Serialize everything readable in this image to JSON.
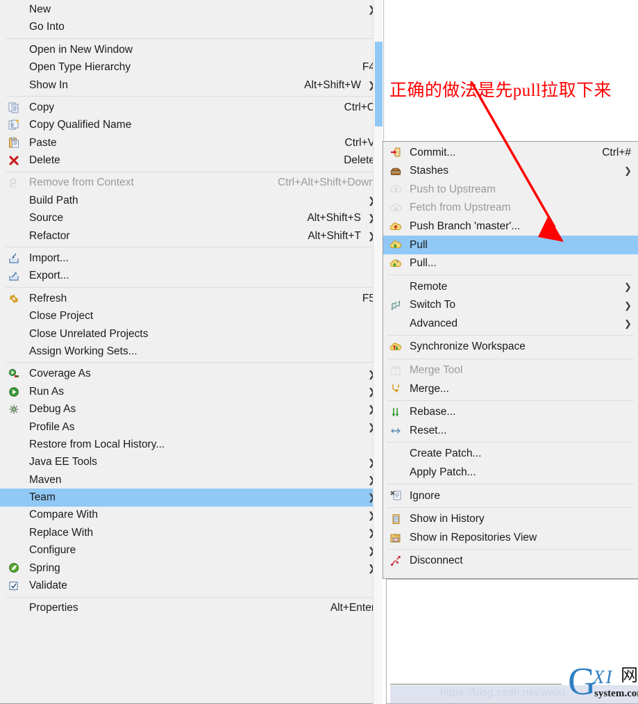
{
  "app": {
    "kind": "eclipse-context-menu",
    "colors": {
      "menu_bg": "#f0f0f0",
      "menu_border": "#9a9a9a",
      "highlight": "#90c8f6",
      "annotation_red": "#ff0000",
      "disabled_text": "#9a9a9a",
      "watermark_blue": "#2f80c2"
    }
  },
  "context_menu": {
    "name": "project-context-menu",
    "groups": [
      {
        "items": [
          {
            "label": "New",
            "accel": "",
            "arrow": true,
            "icon": "",
            "disabled": false,
            "selected": false
          },
          {
            "label": "Go Into",
            "accel": "",
            "arrow": false,
            "icon": "",
            "disabled": false,
            "selected": false
          }
        ]
      },
      {
        "items": [
          {
            "label": "Open in New Window",
            "accel": "",
            "arrow": false,
            "icon": "",
            "disabled": false,
            "selected": false
          },
          {
            "label": "Open Type Hierarchy",
            "accel": "F4",
            "arrow": false,
            "icon": "",
            "disabled": false,
            "selected": false
          },
          {
            "label": "Show In",
            "accel": "Alt+Shift+W",
            "arrow": true,
            "icon": "",
            "disabled": false,
            "selected": false
          }
        ]
      },
      {
        "items": [
          {
            "label": "Copy",
            "accel": "Ctrl+C",
            "arrow": false,
            "icon": "copy-icon",
            "disabled": false,
            "selected": false
          },
          {
            "label": "Copy Qualified Name",
            "accel": "",
            "arrow": false,
            "icon": "copy-qualified-name-icon",
            "disabled": false,
            "selected": false
          },
          {
            "label": "Paste",
            "accel": "Ctrl+V",
            "arrow": false,
            "icon": "paste-icon",
            "disabled": false,
            "selected": false
          },
          {
            "label": "Delete",
            "accel": "Delete",
            "arrow": false,
            "icon": "delete-x-icon",
            "disabled": false,
            "selected": false
          }
        ]
      },
      {
        "items": [
          {
            "label": "Remove from Context",
            "accel": "Ctrl+Alt+Shift+Down",
            "arrow": false,
            "icon": "remove-from-context-icon",
            "disabled": true,
            "selected": false
          },
          {
            "label": "Build Path",
            "accel": "",
            "arrow": true,
            "icon": "",
            "disabled": false,
            "selected": false
          },
          {
            "label": "Source",
            "accel": "Alt+Shift+S",
            "arrow": true,
            "icon": "",
            "disabled": false,
            "selected": false
          },
          {
            "label": "Refactor",
            "accel": "Alt+Shift+T",
            "arrow": true,
            "icon": "",
            "disabled": false,
            "selected": false
          }
        ]
      },
      {
        "items": [
          {
            "label": "Import...",
            "accel": "",
            "arrow": false,
            "icon": "import-icon",
            "disabled": false,
            "selected": false
          },
          {
            "label": "Export...",
            "accel": "",
            "arrow": false,
            "icon": "export-icon",
            "disabled": false,
            "selected": false
          }
        ]
      },
      {
        "items": [
          {
            "label": "Refresh",
            "accel": "F5",
            "arrow": false,
            "icon": "refresh-icon",
            "disabled": false,
            "selected": false
          },
          {
            "label": "Close Project",
            "accel": "",
            "arrow": false,
            "icon": "",
            "disabled": false,
            "selected": false
          },
          {
            "label": "Close Unrelated Projects",
            "accel": "",
            "arrow": false,
            "icon": "",
            "disabled": false,
            "selected": false
          },
          {
            "label": "Assign Working Sets...",
            "accel": "",
            "arrow": false,
            "icon": "",
            "disabled": false,
            "selected": false
          }
        ]
      },
      {
        "items": [
          {
            "label": "Coverage As",
            "accel": "",
            "arrow": true,
            "icon": "coverage-icon",
            "disabled": false,
            "selected": false
          },
          {
            "label": "Run As",
            "accel": "",
            "arrow": true,
            "icon": "run-icon",
            "disabled": false,
            "selected": false
          },
          {
            "label": "Debug As",
            "accel": "",
            "arrow": true,
            "icon": "debug-icon",
            "disabled": false,
            "selected": false
          },
          {
            "label": "Profile As",
            "accel": "",
            "arrow": true,
            "icon": "",
            "disabled": false,
            "selected": false
          },
          {
            "label": "Restore from Local History...",
            "accel": "",
            "arrow": false,
            "icon": "",
            "disabled": false,
            "selected": false
          },
          {
            "label": "Java EE Tools",
            "accel": "",
            "arrow": true,
            "icon": "",
            "disabled": false,
            "selected": false
          },
          {
            "label": "Maven",
            "accel": "",
            "arrow": true,
            "icon": "",
            "disabled": false,
            "selected": false
          },
          {
            "label": "Team",
            "accel": "",
            "arrow": true,
            "icon": "",
            "disabled": false,
            "selected": true
          },
          {
            "label": "Compare With",
            "accel": "",
            "arrow": true,
            "icon": "",
            "disabled": false,
            "selected": false
          },
          {
            "label": "Replace With",
            "accel": "",
            "arrow": true,
            "icon": "",
            "disabled": false,
            "selected": false
          },
          {
            "label": "Configure",
            "accel": "",
            "arrow": true,
            "icon": "",
            "disabled": false,
            "selected": false
          },
          {
            "label": "Spring",
            "accel": "",
            "arrow": true,
            "icon": "spring-leaf-icon",
            "disabled": false,
            "selected": false
          },
          {
            "label": "Validate",
            "accel": "",
            "arrow": false,
            "icon": "checkbox-checked-icon",
            "disabled": false,
            "selected": false
          }
        ]
      },
      {
        "items": [
          {
            "label": "Properties",
            "accel": "Alt+Enter",
            "arrow": false,
            "icon": "",
            "disabled": false,
            "selected": false
          }
        ]
      }
    ]
  },
  "team_submenu": {
    "name": "team-submenu",
    "groups": [
      {
        "items": [
          {
            "label": "Commit...",
            "accel": "Ctrl+#",
            "arrow": false,
            "icon": "commit-icon",
            "disabled": false,
            "selected": false
          },
          {
            "label": "Stashes",
            "accel": "",
            "arrow": true,
            "icon": "stashes-icon",
            "disabled": false,
            "selected": false
          },
          {
            "label": "Push to Upstream",
            "accel": "",
            "arrow": false,
            "icon": "push-upstream-icon",
            "disabled": true,
            "selected": false
          },
          {
            "label": "Fetch from Upstream",
            "accel": "",
            "arrow": false,
            "icon": "fetch-upstream-icon",
            "disabled": true,
            "selected": false
          },
          {
            "label": "Push Branch 'master'...",
            "accel": "",
            "arrow": false,
            "icon": "push-branch-icon",
            "disabled": false,
            "selected": false
          },
          {
            "label": "Pull",
            "accel": "",
            "arrow": false,
            "icon": "pull-icon",
            "disabled": false,
            "selected": true
          },
          {
            "label": "Pull...",
            "accel": "",
            "arrow": false,
            "icon": "pull-config-icon",
            "disabled": false,
            "selected": false
          }
        ]
      },
      {
        "items": [
          {
            "label": "Remote",
            "accel": "",
            "arrow": true,
            "icon": "",
            "disabled": false,
            "selected": false
          },
          {
            "label": "Switch To",
            "accel": "",
            "arrow": true,
            "icon": "switch-to-icon",
            "disabled": false,
            "selected": false
          },
          {
            "label": "Advanced",
            "accel": "",
            "arrow": true,
            "icon": "",
            "disabled": false,
            "selected": false
          }
        ]
      },
      {
        "items": [
          {
            "label": "Synchronize Workspace",
            "accel": "",
            "arrow": false,
            "icon": "synchronize-icon",
            "disabled": false,
            "selected": false
          }
        ]
      },
      {
        "items": [
          {
            "label": "Merge Tool",
            "accel": "",
            "arrow": false,
            "icon": "merge-tool-icon",
            "disabled": true,
            "selected": false
          },
          {
            "label": "Merge...",
            "accel": "",
            "arrow": false,
            "icon": "merge-icon",
            "disabled": false,
            "selected": false
          }
        ]
      },
      {
        "items": [
          {
            "label": "Rebase...",
            "accel": "",
            "arrow": false,
            "icon": "rebase-icon",
            "disabled": false,
            "selected": false
          },
          {
            "label": "Reset...",
            "accel": "",
            "arrow": false,
            "icon": "reset-icon",
            "disabled": false,
            "selected": false
          }
        ]
      },
      {
        "items": [
          {
            "label": "Create Patch...",
            "accel": "",
            "arrow": false,
            "icon": "",
            "disabled": false,
            "selected": false
          },
          {
            "label": "Apply Patch...",
            "accel": "",
            "arrow": false,
            "icon": "",
            "disabled": false,
            "selected": false
          }
        ]
      },
      {
        "items": [
          {
            "label": "Ignore",
            "accel": "",
            "arrow": false,
            "icon": "ignore-icon",
            "disabled": false,
            "selected": false
          }
        ]
      },
      {
        "items": [
          {
            "label": "Show in History",
            "accel": "",
            "arrow": false,
            "icon": "history-icon",
            "disabled": false,
            "selected": false
          },
          {
            "label": "Show in Repositories View",
            "accel": "",
            "arrow": false,
            "icon": "git-repositories-icon",
            "disabled": false,
            "selected": false
          }
        ]
      },
      {
        "items": [
          {
            "label": "Disconnect",
            "accel": "",
            "arrow": false,
            "icon": "disconnect-icon",
            "disabled": false,
            "selected": false
          }
        ]
      }
    ]
  },
  "annotation": {
    "text": "正确的做法是先pull拉取下来",
    "color": "#ff0000",
    "points_to": "Pull"
  },
  "watermark": {
    "url": "https://blog.csdn.net/weixi",
    "logo_g": "G",
    "logo_xi": "XI",
    "logo_wang": "网",
    "logo_sub": "system.com"
  }
}
